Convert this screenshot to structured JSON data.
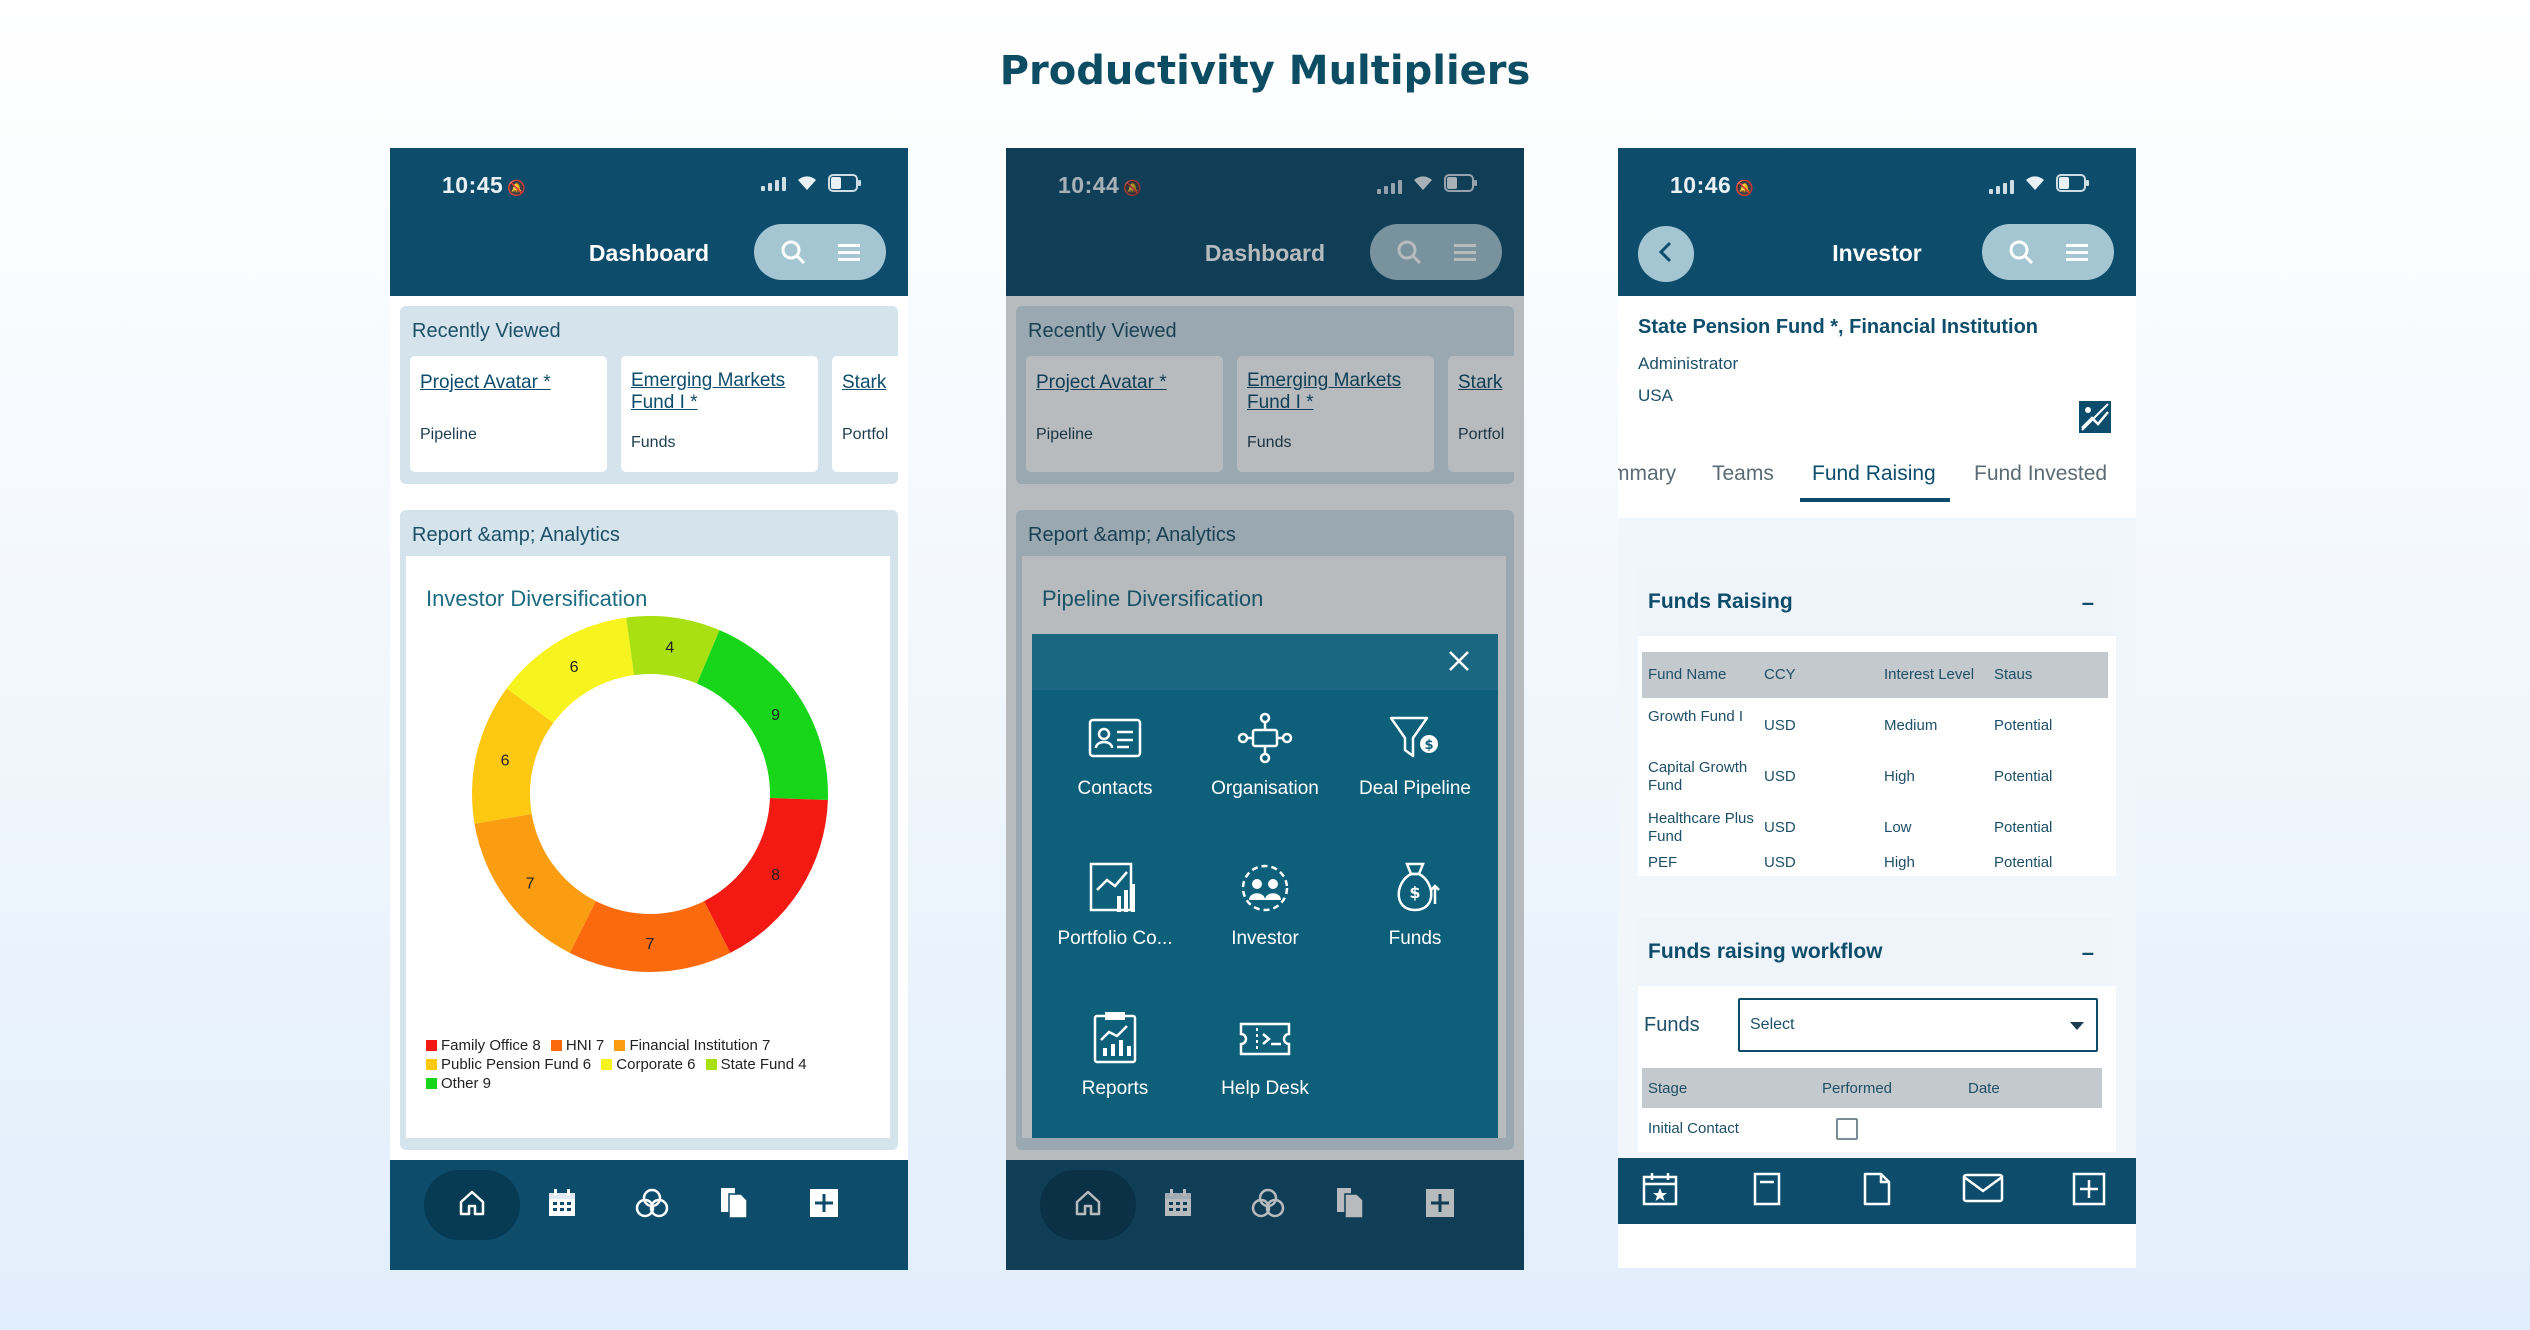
{
  "page": {
    "title": "Productivity Multipliers"
  },
  "phone1": {
    "time": "10:45",
    "title": "Dashboard",
    "recent_title": "Recently Viewed",
    "cards": [
      {
        "link": "Project Avatar *",
        "sub": "Pipeline"
      },
      {
        "link": "Emerging Markets Fund I *",
        "sub": "Funds"
      },
      {
        "link": "Stark",
        "sub": "Portfol"
      }
    ],
    "report_title": "Report &amp; Analytics",
    "chart_title": "Investor Diversification"
  },
  "phone2": {
    "time": "10:44",
    "title": "Dashboard",
    "recent_title": "Recently Viewed",
    "cards": [
      {
        "link": "Project Avatar *",
        "sub": "Pipeline"
      },
      {
        "link": "Emerging Markets Fund I *",
        "sub": "Funds"
      },
      {
        "link": "Stark",
        "sub": "Portfol"
      }
    ],
    "report_title": "Report &amp; Analytics",
    "chart_title": "Pipeline Diversification",
    "menu": [
      {
        "label": "Contacts",
        "icon": "contact-card-icon"
      },
      {
        "label": "Organisation",
        "icon": "organisation-network-icon"
      },
      {
        "label": "Deal Pipeline",
        "icon": "funnel-dollar-icon"
      },
      {
        "label": "Portfolio Co...",
        "icon": "portfolio-chart-icon"
      },
      {
        "label": "Investor",
        "icon": "investor-icon"
      },
      {
        "label": "Funds",
        "icon": "money-bag-icon"
      },
      {
        "label": "Reports",
        "icon": "report-clipboard-icon"
      },
      {
        "label": "Help Desk",
        "icon": "help-desk-ticket-icon"
      }
    ]
  },
  "phone3": {
    "time": "10:46",
    "title": "Investor",
    "investor_name": "State Pension Fund *, Financial Institution",
    "role": "Administrator",
    "country": "USA",
    "tabs": [
      "mmary",
      "Teams",
      "Fund Raising",
      "Fund Invested"
    ],
    "active_tab": "Fund Raising",
    "funds_raising": {
      "title": "Funds Raising",
      "collapse": "–",
      "columns": [
        "Fund Name",
        "CCY",
        "Interest Level",
        "Staus"
      ],
      "rows": [
        [
          "Growth Fund I",
          "USD",
          "Medium",
          "Potential"
        ],
        [
          "Capital Growth Fund",
          "USD",
          "High",
          "Potential"
        ],
        [
          "Healthcare Plus Fund",
          "USD",
          "Low",
          "Potential"
        ],
        [
          "PEF",
          "USD",
          "High",
          "Potential"
        ]
      ]
    },
    "workflow": {
      "title": "Funds raising workflow",
      "collapse": "–",
      "funds_label": "Funds",
      "select_value": "Select",
      "columns": [
        "Stage",
        "Performed",
        "Date"
      ],
      "rows": [
        {
          "stage": "Initial Contact",
          "performed": false
        }
      ]
    }
  },
  "chart_data": {
    "type": "pie",
    "title": "Investor Diversification",
    "categories": [
      "Family Office",
      "HNI",
      "Financial Institution",
      "Public Pension Fund",
      "Corporate",
      "State Fund",
      "Other"
    ],
    "values": [
      8,
      7,
      7,
      6,
      6,
      4,
      9
    ],
    "colors": [
      "#f21a12",
      "#fb6a0c",
      "#fb9d10",
      "#fcc812",
      "#f7f31e",
      "#a8e012",
      "#17d61a"
    ],
    "legend_position": "bottom",
    "legend": [
      "Family Office 8",
      "HNI 7",
      "Financial Institution 7",
      "Public Pension Fund 6",
      "Corporate 6",
      "State Fund 4",
      "Other 9"
    ]
  }
}
